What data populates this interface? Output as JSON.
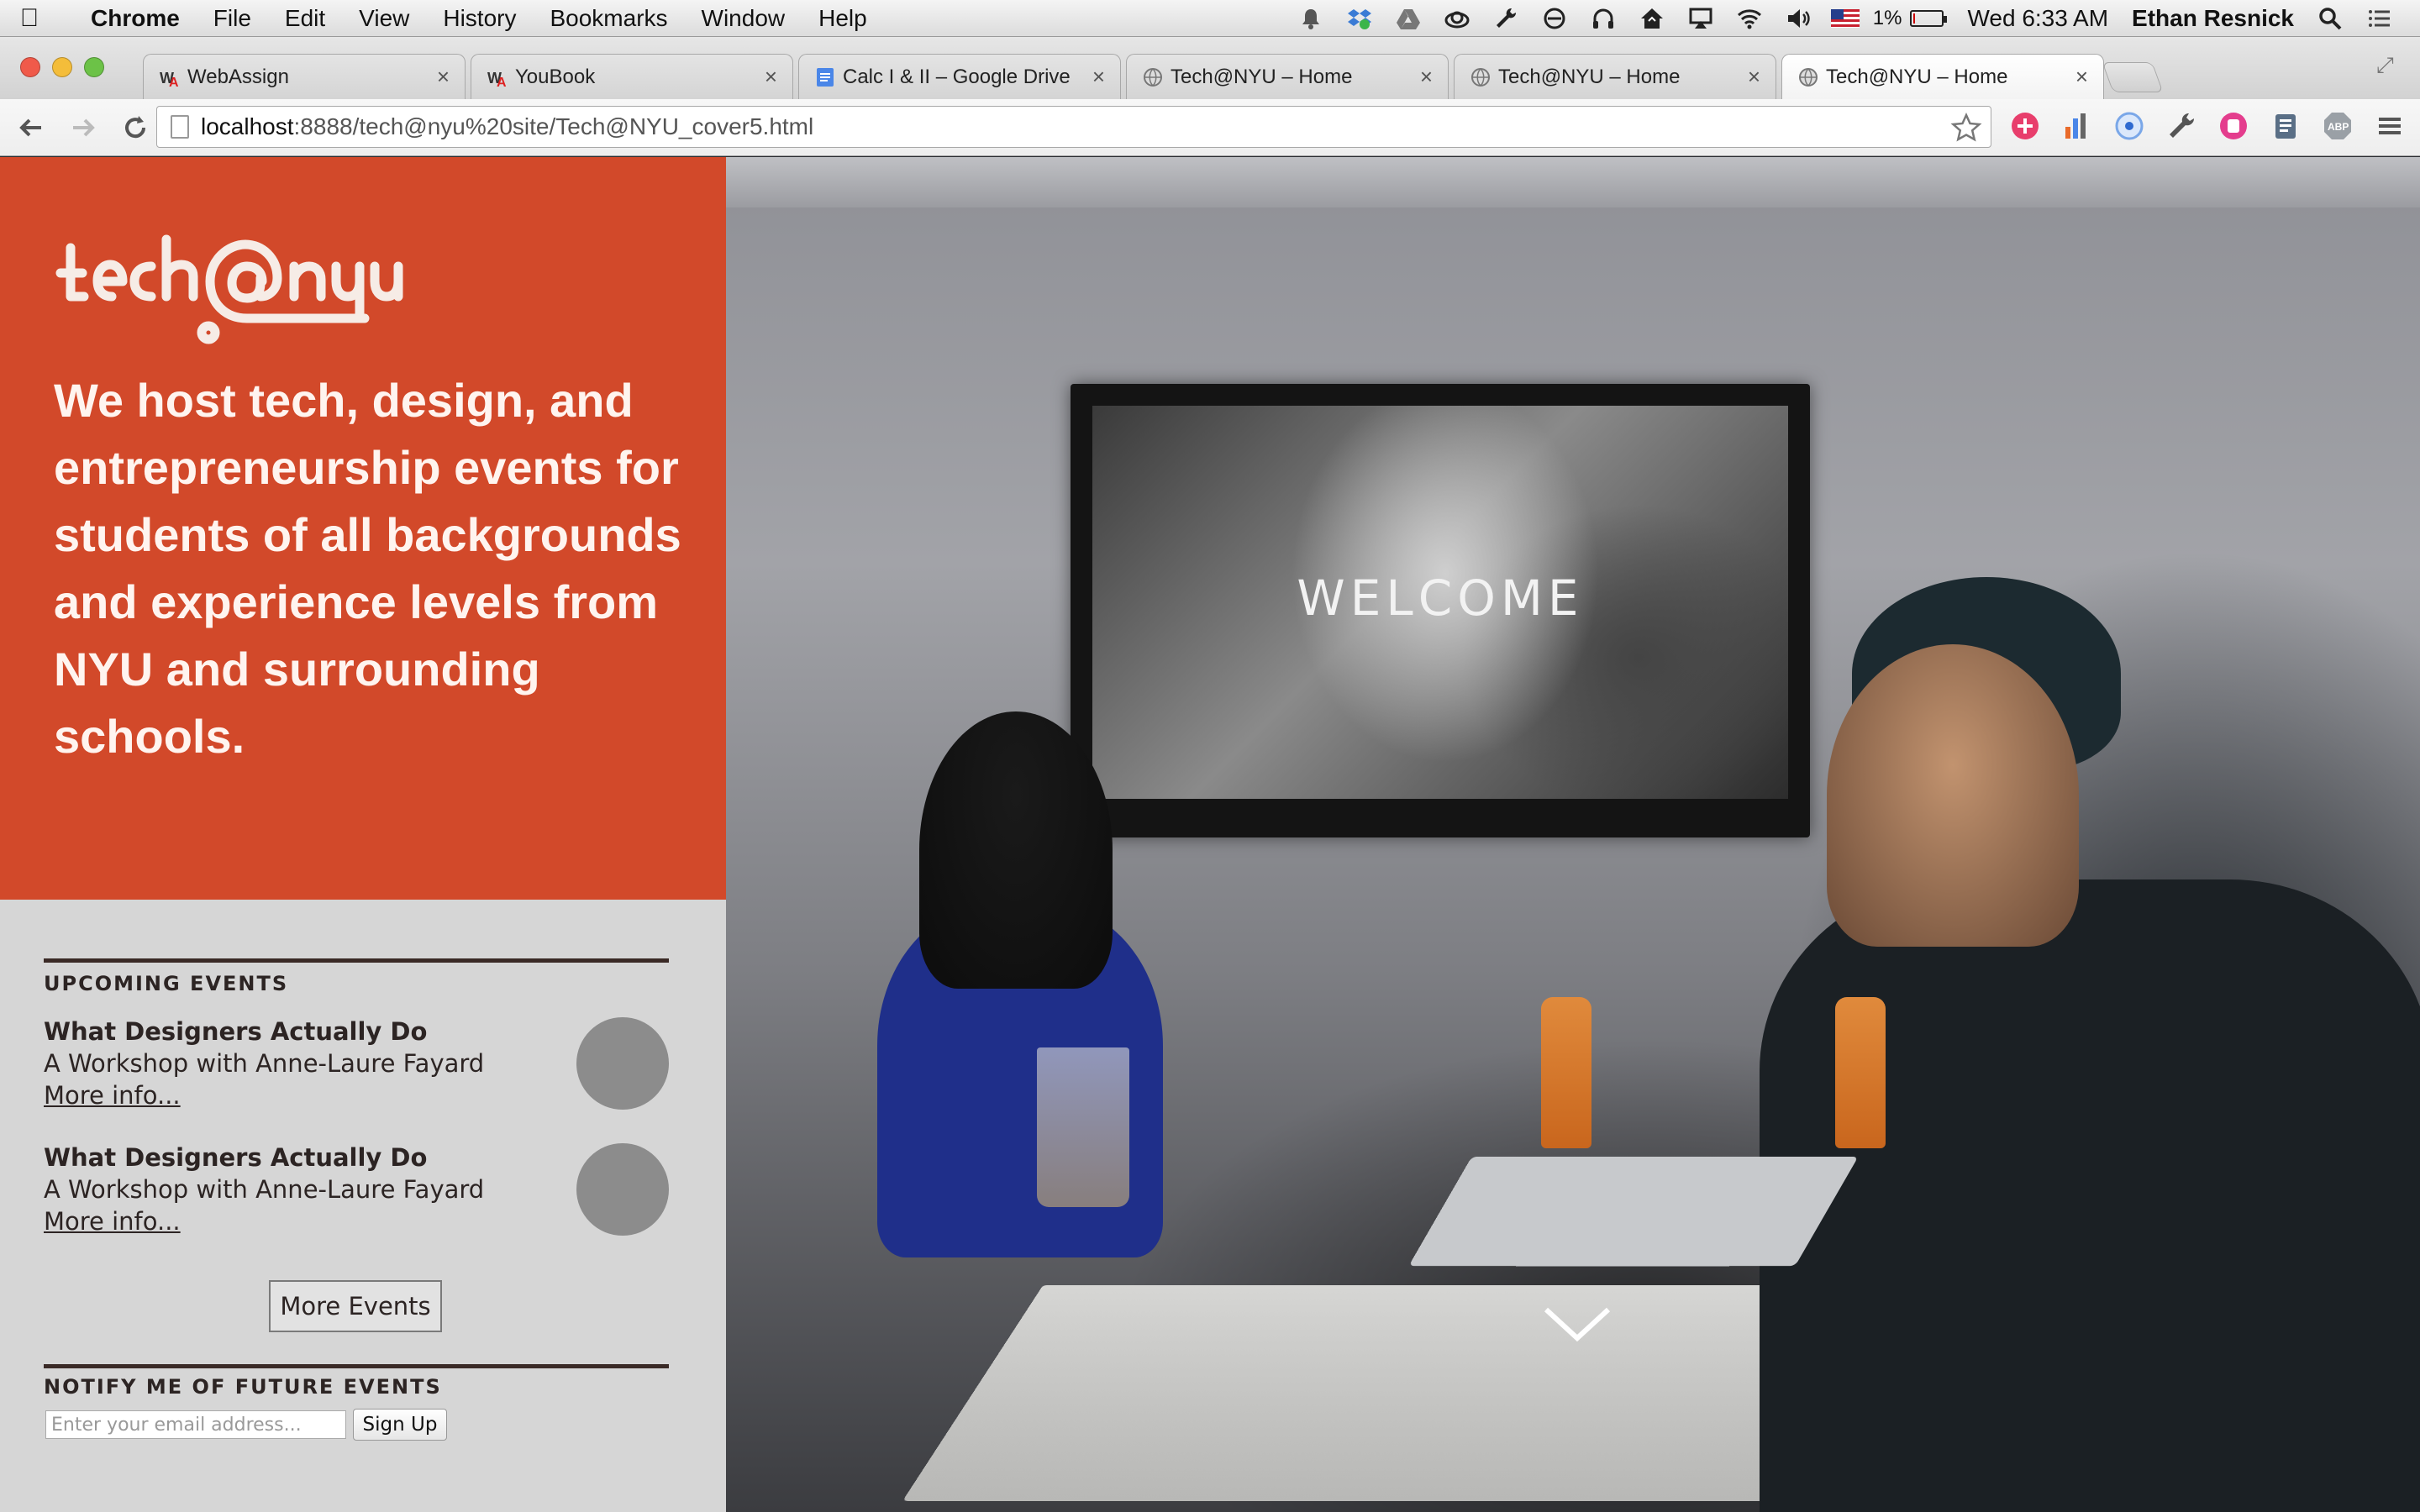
{
  "menubar": {
    "apple_icon": "apple-icon",
    "items": [
      "Chrome",
      "File",
      "Edit",
      "View",
      "History",
      "Bookmarks",
      "Window",
      "Help"
    ],
    "battery_percent": "1%",
    "clock": "Wed 6:33 AM",
    "user": "Ethan Resnick",
    "status_icons": [
      "notification-icon",
      "dropbox-icon",
      "drive-icon",
      "creative-cloud-icon",
      "wrench-icon",
      "do-not-disturb-icon",
      "headphones-icon",
      "home-sync-icon",
      "airplay-icon",
      "wifi-icon",
      "volume-icon",
      "flag-icon",
      "battery-icon",
      "spotlight-icon",
      "notification-center-icon"
    ]
  },
  "tabs": [
    {
      "label": "WebAssign",
      "favicon": "webassign-icon",
      "active": false
    },
    {
      "label": "YouBook",
      "favicon": "webassign-icon",
      "active": false
    },
    {
      "label": "Calc I & II – Google Drive",
      "favicon": "google-docs-icon",
      "active": false
    },
    {
      "label": "Tech@NYU – Home",
      "favicon": "globe-icon",
      "active": false
    },
    {
      "label": "Tech@NYU – Home",
      "favicon": "globe-icon",
      "active": false
    },
    {
      "label": "Tech@NYU – Home",
      "favicon": "globe-icon",
      "active": true
    }
  ],
  "toolbar": {
    "url_host": "localhost",
    "url_path": ":8888/tech@nyu%20site/Tech@NYU_cover5.html",
    "extensions": [
      "add-plus-icon",
      "stats-icon",
      "target-icon",
      "wrench-icon",
      "pink-extension-icon",
      "clipboard-icon",
      "adblock-icon",
      "menu-icon"
    ]
  },
  "hero": {
    "logo_text": "tech@nyu",
    "tagline": "We host tech, design, and entrepreneurship events for students of all backgrounds and experience levels from NYU and surrounding schools."
  },
  "photo": {
    "screen_text": "WELCOME"
  },
  "upcoming": {
    "heading": "UPCOMING EVENTS",
    "events": [
      {
        "title": "What Designers Actually Do",
        "subtitle": "A Workshop with Anne-Laure Fayard",
        "link": "More info..."
      },
      {
        "title": "What Designers Actually Do",
        "subtitle": "A Workshop with Anne-Laure Fayard",
        "link": "More info..."
      }
    ],
    "more_button": "More Events"
  },
  "notify": {
    "heading": "NOTIFY ME OF FUTURE EVENTS",
    "email_placeholder": "Enter your email address...",
    "signup_button": "Sign Up"
  },
  "colors": {
    "hero_bg": "#d2492a",
    "sidebar_bg": "#d6d6d6",
    "text_dark": "#2c2423"
  }
}
